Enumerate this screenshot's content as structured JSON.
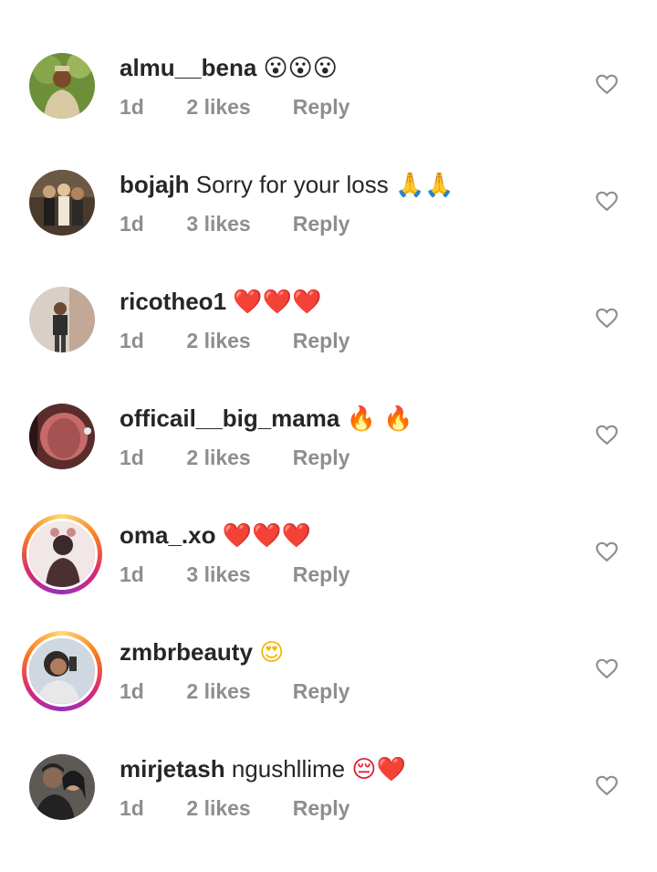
{
  "comments": [
    {
      "username": "almu__bena",
      "text": "",
      "emoji": "😮😮😮",
      "time": "1d",
      "likes": "2 likes",
      "reply": "Reply",
      "avatar_colors": [
        "#6d8f3a",
        "#d9c9a3"
      ],
      "story_ring": false
    },
    {
      "username": "bojajh",
      "text": "Sorry for your loss",
      "emoji": "🙏🙏",
      "time": "1d",
      "likes": "3 likes",
      "reply": "Reply",
      "avatar_colors": [
        "#4a3a2c",
        "#c8a27a"
      ],
      "story_ring": false
    },
    {
      "username": "ricotheo1",
      "text": "",
      "emoji": "❤️❤️❤️",
      "time": "1d",
      "likes": "2 likes",
      "reply": "Reply",
      "avatar_colors": [
        "#d8cfc6",
        "#3a3a3a"
      ],
      "story_ring": false
    },
    {
      "username": "officail__big_mama",
      "text": "",
      "emoji": "🔥 🔥",
      "time": "1d",
      "likes": "2 likes",
      "reply": "Reply",
      "avatar_colors": [
        "#c76a6a",
        "#5a2d2d"
      ],
      "story_ring": false
    },
    {
      "username": "oma_.xo",
      "text": "",
      "emoji": "❤️❤️❤️",
      "time": "1d",
      "likes": "3 likes",
      "reply": "Reply",
      "avatar_colors": [
        "#f1e7e7",
        "#3b2a2a"
      ],
      "story_ring": true
    },
    {
      "username": "zmbrbeauty",
      "text": "",
      "emoji": "😍",
      "time": "1d",
      "likes": "2 likes",
      "reply": "Reply",
      "avatar_colors": [
        "#cfd8e0",
        "#2f2a28"
      ],
      "story_ring": true
    },
    {
      "username": "mirjetash",
      "text": "ngushllime",
      "emoji": "😔❤️",
      "time": "1d",
      "likes": "2 likes",
      "reply": "Reply",
      "avatar_colors": [
        "#5d5a56",
        "#222222"
      ],
      "story_ring": false
    }
  ],
  "like_icon": "heart-outline-icon",
  "colors": {
    "username": "#262626",
    "meta": "#8e8e8e",
    "heart": "#8e8e8e",
    "background": "#ffffff"
  }
}
